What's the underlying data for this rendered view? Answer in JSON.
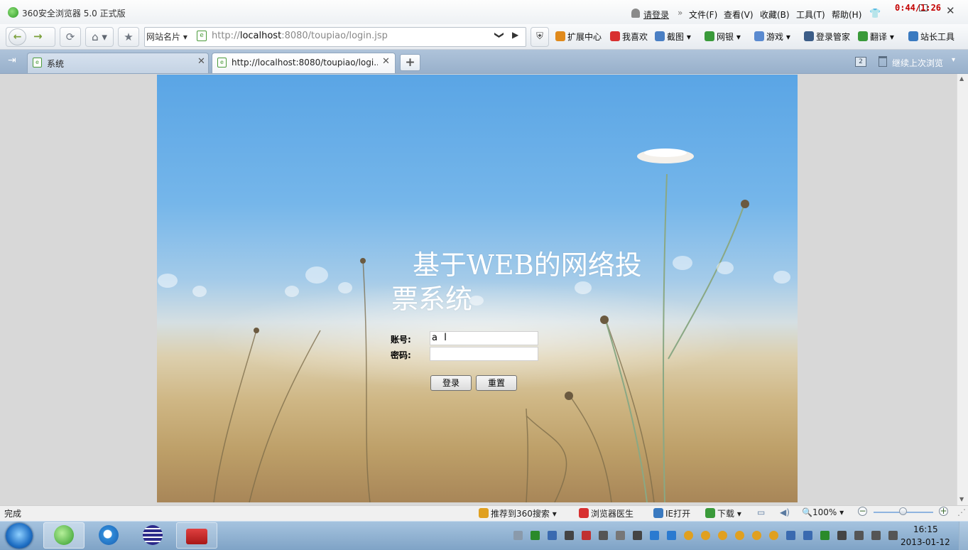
{
  "titlebar": {
    "app_title": "360安全浏览器 5.0 正式版",
    "login_link": "请登录",
    "more": "»",
    "menus": [
      "文件(F)",
      "查看(V)",
      "收藏(B)",
      "工具(T)",
      "帮助(H)"
    ],
    "timer": "0:44/1:26",
    "close": "✕"
  },
  "toolbar": {
    "back": "←",
    "forward": "→",
    "refresh": "⟳",
    "home": "⌂ ▾",
    "favorite": "★",
    "site_card": "网站名片 ▾",
    "url_scheme_host": "http://",
    "url_host": "localhost",
    "url_rest": ":8080/toupiao/login.jsp",
    "url_dropdown": "❯",
    "url_go": "▶",
    "shield": "⛨",
    "items": [
      {
        "label": "扩展中心",
        "icon": "cube-icon",
        "color": "#e08a1c"
      },
      {
        "label": "我喜欢",
        "icon": "heart-icon",
        "color": "#d83030"
      },
      {
        "label": "截图 ▾",
        "icon": "screenshot-icon",
        "color": "#4a7fc4"
      },
      {
        "label": "网银 ▾",
        "icon": "bank-icon",
        "color": "#3a9a3a"
      },
      {
        "label": "游戏 ▾",
        "icon": "game-icon",
        "color": "#5a8ad0"
      },
      {
        "label": "登录管家",
        "icon": "key-icon",
        "color": "#3c5d88"
      },
      {
        "label": "翻译 ▾",
        "icon": "translate-icon",
        "color": "#3a9a3a"
      },
      {
        "label": "站长工具",
        "icon": "webmaster-icon",
        "color": "#3a7ac0"
      }
    ]
  },
  "tabs": [
    {
      "label": "系统",
      "close": "✕"
    },
    {
      "label": "http://localhost:8080/toupiao/logi...",
      "close": "✕"
    }
  ],
  "new_tab": "+",
  "tab_count": "2",
  "restore_label": "继续上次浏览",
  "restore_arrow": "▾",
  "page": {
    "heading": "基于WEB的网络投票系统",
    "account_label": "账号:",
    "password_label": "密码:",
    "account_value": "a",
    "login_button": "登录",
    "reset_button": "重置"
  },
  "statusbar": {
    "status": "完成",
    "recommend": "推荐到360搜索 ▾",
    "doctor": "浏览器医生",
    "ie_open": "IE打开",
    "download": "下载 ▾",
    "zoom": "100% ▾",
    "zoom_level": 0.5
  },
  "taskbar": {
    "time": "16:15",
    "date": "2013-01-12",
    "tray_colors": [
      "#8a9aab",
      "#2a8a2a",
      "#3a6ab0",
      "#444",
      "#c03030",
      "#555",
      "#777",
      "#444",
      "#2a7ad0",
      "#2a7ad0",
      "#e0a020",
      "#e0a020",
      "#e0a020",
      "#e0a020",
      "#e0a020",
      "#e0a020",
      "#3a6ab0",
      "#3a6ab0",
      "#2a8a2a",
      "#444",
      "#555",
      "#555",
      "#555"
    ]
  }
}
